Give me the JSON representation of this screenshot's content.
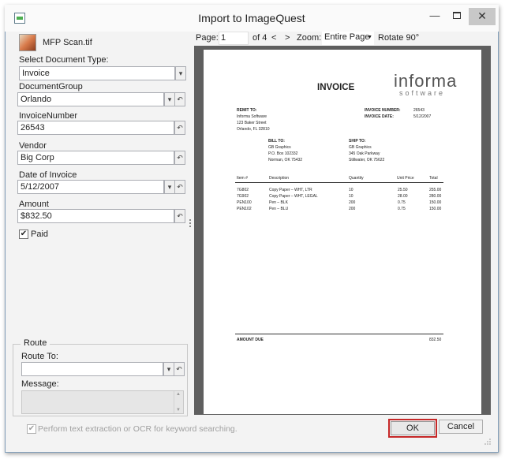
{
  "window": {
    "title": "Import to ImageQuest",
    "minimize": "—",
    "close": "✕"
  },
  "file": {
    "name": "MFP Scan.tif"
  },
  "fields": {
    "doc_type_label": "Select Document Type:",
    "doc_type_value": "Invoice",
    "group_label": "DocumentGroup",
    "group_value": "Orlando",
    "invoice_number_label": "InvoiceNumber",
    "invoice_number_value": "26543",
    "vendor_label": "Vendor",
    "vendor_value": "Big Corp",
    "date_label": "Date of Invoice",
    "date_value": "5/12/2007",
    "amount_label": "Amount",
    "amount_value": "$832.50",
    "paid_label": "Paid",
    "paid_checked": true
  },
  "route": {
    "legend": "Route",
    "route_to_label": "Route To:",
    "route_to_value": "",
    "message_label": "Message:"
  },
  "toolbar": {
    "page_label": "Page:",
    "page_value": "1",
    "of_label": "of 4",
    "prev": "<",
    "next": ">",
    "zoom_label": "Zoom:",
    "zoom_value": "Entire Page",
    "rotate_label": "Rotate 90°"
  },
  "invoice": {
    "title": "INVOICE",
    "logo_main": "informa",
    "logo_sub": "software",
    "remit_to_label": "REMIT TO:",
    "remit_to_lines": [
      "Informa Software",
      "123 Baker Street",
      "Orlando, FL  32810"
    ],
    "invoice_number_label": "INVOICE NUMBER:",
    "invoice_number": "26543",
    "invoice_date_label": "INVOICE DATE:",
    "invoice_date": "5/12/2007",
    "bill_to_label": "BILL TO:",
    "bill_to_lines": [
      "GB Graphics",
      "P.O. Box 102332",
      "Norman, OK  75432"
    ],
    "ship_to_label": "SHIP TO:",
    "ship_to_lines": [
      "GB Graphics",
      "345 Oak Parkway",
      "Stillwater, OK  75622"
    ],
    "columns": [
      "Item #",
      "Description",
      "Quantity",
      "Unit Price",
      "Total"
    ],
    "rows": [
      [
        "7G802",
        "Copy Paper – WHT, LTR",
        "10",
        "25.50",
        "255.00"
      ],
      [
        "7G902",
        "Copy Paper – WHT, LEGAL",
        "10",
        "28.00",
        "280.00"
      ],
      [
        "PEN100",
        "Pen – BLK",
        "200",
        "0.75",
        "150.00"
      ],
      [
        "PEN102",
        "Pen – BLU",
        "200",
        "0.75",
        "150.00"
      ]
    ],
    "amount_due_label": "AMOUNT DUE",
    "amount_due": "832.50"
  },
  "footer": {
    "ocr_label": "Perform text extraction or OCR for keyword searching.",
    "ocr_checked": true,
    "ok_label": "OK",
    "cancel_label": "Cancel"
  },
  "icons": {
    "dropdown": "chevron-down-icon",
    "reset": "undo-icon",
    "check": "✔"
  }
}
